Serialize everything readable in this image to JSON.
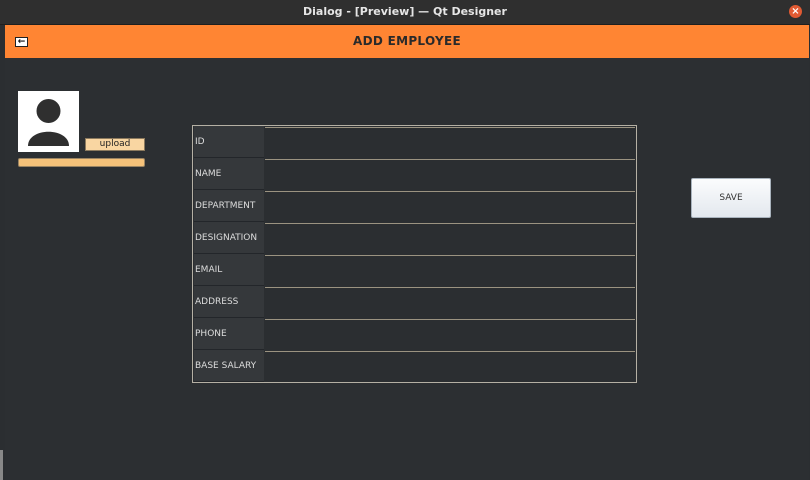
{
  "window": {
    "title": "Dialog - [Preview] — Qt Designer",
    "close_label": "×"
  },
  "header": {
    "title": "ADD EMPLOYEE",
    "back_icon": "arrow-left-icon",
    "color": "#ff8533"
  },
  "photo": {
    "icon": "user-avatar-icon",
    "upload_label": "upload"
  },
  "progress": {
    "value_percent": 100
  },
  "form": {
    "fields": [
      {
        "label": "ID",
        "value": ""
      },
      {
        "label": "NAME",
        "value": ""
      },
      {
        "label": "DEPARTMENT",
        "value": ""
      },
      {
        "label": "DESIGNATION",
        "value": ""
      },
      {
        "label": "EMAIL",
        "value": ""
      },
      {
        "label": "ADDRESS",
        "value": ""
      },
      {
        "label": "PHONE",
        "value": ""
      },
      {
        "label": "BASE SALARY",
        "value": ""
      }
    ]
  },
  "actions": {
    "save_label": "SAVE"
  }
}
